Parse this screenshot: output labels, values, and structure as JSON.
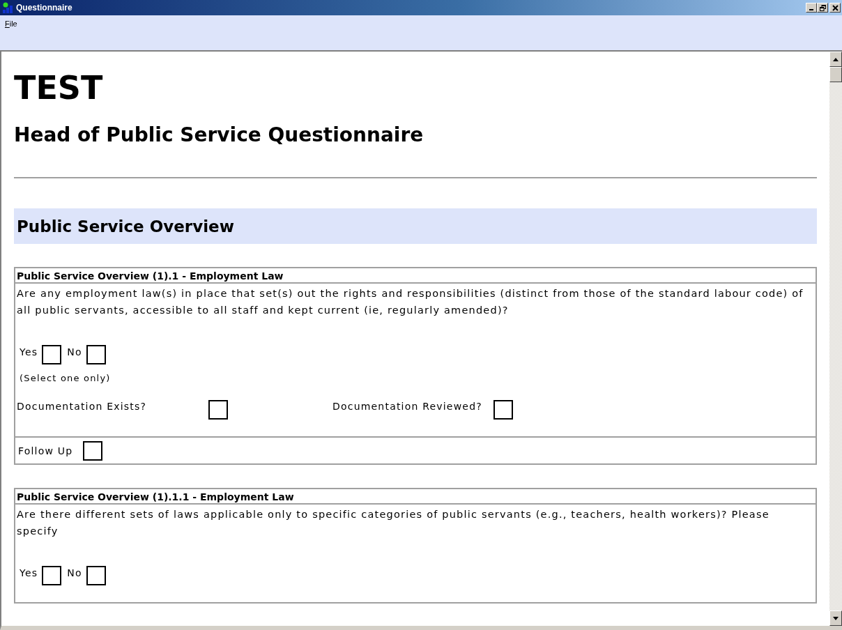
{
  "window": {
    "title": "Questionnaire"
  },
  "menu": [
    {
      "label": "File"
    }
  ],
  "title": "TEST",
  "subtitle": "Head of Public Service Questionnaire",
  "section": "Public Service Overview",
  "questions": [
    {
      "title": "Public Service Overview (1).1 - Employment Law",
      "text": "Are any employment law(s) in place that set(s) out the rights and responsibilities (distinct from those of the standard labour code) of all public servants, accessible to all staff and kept current (ie, regularly amended)?",
      "options": [
        {
          "label": "Yes",
          "checked": false
        },
        {
          "label": "No",
          "checked": false
        }
      ],
      "hint": "(Select one only)",
      "documentation": [
        {
          "label": "Documentation Exists?",
          "checked": false
        },
        {
          "label": "Documentation Reviewed?",
          "checked": false
        }
      ],
      "follow_up": {
        "label": "Follow Up",
        "checked": false
      }
    },
    {
      "title": "Public Service Overview (1).1.1 - Employment Law",
      "text": "Are there different sets of laws applicable only to specific categories of public servants (e.g., teachers, health workers)? Please specify",
      "options": [
        {
          "label": "Yes",
          "checked": false
        },
        {
          "label": "No",
          "checked": false
        }
      ]
    }
  ]
}
